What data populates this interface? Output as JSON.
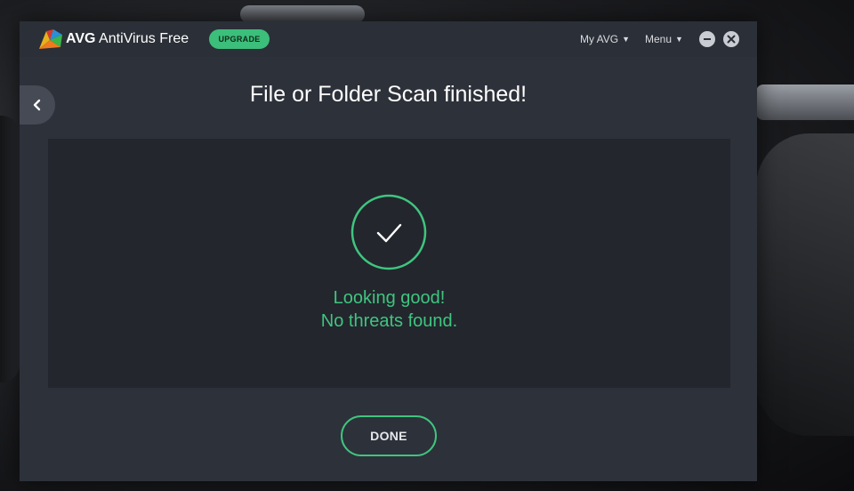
{
  "app": {
    "brand_bold": "AVG",
    "brand_rest": "AntiVirus Free",
    "upgrade_label": "UPGRADE",
    "my_avg_label": "My AVG",
    "menu_label": "Menu"
  },
  "icons": {
    "logo": "avg-logo-icon",
    "chevron": "chevron-down-icon",
    "minimize": "minimize-icon",
    "close": "close-icon",
    "back": "chevron-left-icon",
    "check": "checkmark-icon"
  },
  "main": {
    "title": "File or Folder Scan finished!",
    "result_line1": "Looking good!",
    "result_line2": "No threats found.",
    "done_label": "DONE"
  },
  "colors": {
    "accent_green": "#3fc57f",
    "upgrade_green": "#3bbf7a",
    "window_bg": "#2d313a",
    "panel_bg": "#23262d"
  }
}
